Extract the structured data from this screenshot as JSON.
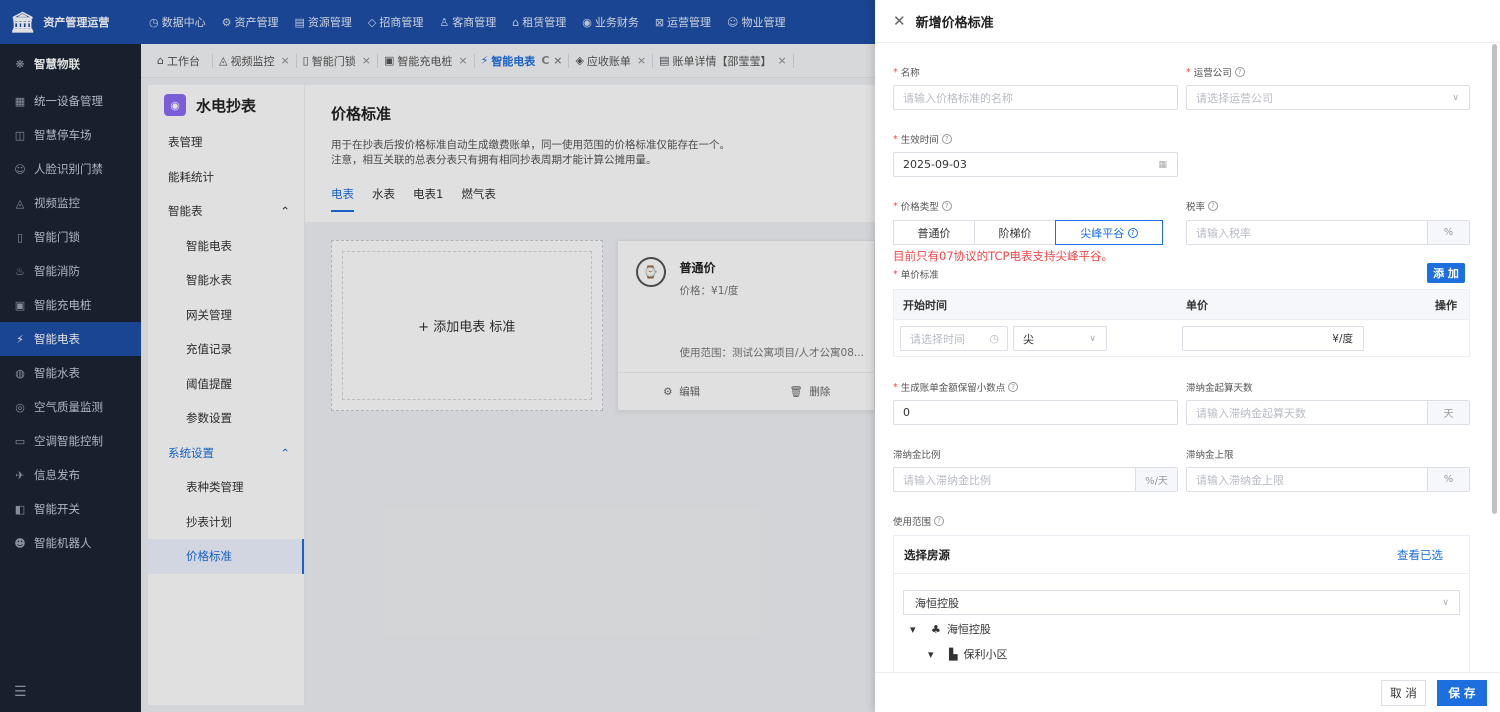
{
  "app": {
    "title": "资产管理运营"
  },
  "topnav": [
    {
      "icon": "◷",
      "label": "数据中心"
    },
    {
      "icon": "⚙",
      "label": "资产管理"
    },
    {
      "icon": "▤",
      "label": "资源管理"
    },
    {
      "icon": "◇",
      "label": "招商管理"
    },
    {
      "icon": "♙",
      "label": "客商管理"
    },
    {
      "icon": "⌂",
      "label": "租赁管理"
    },
    {
      "icon": "◉",
      "label": "业务财务"
    },
    {
      "icon": "⊠",
      "label": "运营管理"
    },
    {
      "icon": "☺",
      "label": "物业管理"
    }
  ],
  "sidebar": {
    "head": {
      "icon": "❋",
      "label": "智慧物联"
    },
    "items": [
      {
        "icon": "▦",
        "label": "统一设备管理"
      },
      {
        "icon": "◫",
        "label": "智慧停车场"
      },
      {
        "icon": "☺",
        "label": "人脸识别门禁"
      },
      {
        "icon": "◬",
        "label": "视频监控"
      },
      {
        "icon": "▯",
        "label": "智能门锁"
      },
      {
        "icon": "♨",
        "label": "智能消防"
      },
      {
        "icon": "▣",
        "label": "智能充电桩"
      },
      {
        "icon": "⚡",
        "label": "智能电表"
      },
      {
        "icon": "◍",
        "label": "智能水表"
      },
      {
        "icon": "◎",
        "label": "空气质量监测"
      },
      {
        "icon": "▭",
        "label": "空调智能控制"
      },
      {
        "icon": "✈",
        "label": "信息发布"
      },
      {
        "icon": "◧",
        "label": "智能开关"
      },
      {
        "icon": "☻",
        "label": "智能机器人"
      }
    ]
  },
  "tabs": [
    {
      "icon": "⌂",
      "label": "工作台",
      "close": ""
    },
    {
      "icon": "◬",
      "label": "视频监控",
      "close": "×"
    },
    {
      "icon": "▯",
      "label": "智能门锁",
      "close": "×"
    },
    {
      "icon": "▣",
      "label": "智能充电桩",
      "close": "×"
    },
    {
      "icon": "⚡",
      "label": "智能电表",
      "close": "C ×"
    },
    {
      "icon": "◈",
      "label": "应收账单",
      "close": "×"
    },
    {
      "icon": "▤",
      "label": "账单详情【邵莹莹】",
      "close": "×"
    }
  ],
  "subside": {
    "title": "水电抄表",
    "items": [
      {
        "label": "表管理",
        "arrow": "",
        "cls": ""
      },
      {
        "label": "能耗统计",
        "arrow": "",
        "cls": ""
      },
      {
        "label": "智能表",
        "arrow": "⌃",
        "cls": ""
      },
      {
        "label": "智能电表",
        "arrow": "",
        "cls": "sub"
      },
      {
        "label": "智能水表",
        "arrow": "",
        "cls": "sub"
      },
      {
        "label": "网关管理",
        "arrow": "",
        "cls": "sub"
      },
      {
        "label": "充值记录",
        "arrow": "",
        "cls": "sub"
      },
      {
        "label": "阈值提醒",
        "arrow": "",
        "cls": "sub"
      },
      {
        "label": "参数设置",
        "arrow": "",
        "cls": "sub"
      },
      {
        "label": "系统设置",
        "arrow": "⌃",
        "cls": "blue"
      },
      {
        "label": "表种类管理",
        "arrow": "",
        "cls": "sub"
      },
      {
        "label": "抄表计划",
        "arrow": "",
        "cls": "sub"
      },
      {
        "label": "价格标准",
        "arrow": "",
        "cls": "sub active"
      }
    ]
  },
  "main": {
    "title": "价格标准",
    "desc1": "用于在抄表后按价格标准自动生成缴费账单，同一使用范围的价格标准仅能存在一个。",
    "desc2": "注意，相互关联的总表分表只有拥有相同抄表周期才能计算公摊用量。",
    "tabs": [
      "电表",
      "水表",
      "电表1",
      "燃气表"
    ],
    "add_card": "+ 添加电表 标准",
    "card": {
      "name": "普通价",
      "price": "价格：¥1/度",
      "scope": "使用范围：测试公寓项目/人才公寓08...",
      "edit": "编辑",
      "delete": "删除"
    }
  },
  "drawer": {
    "title": "新增价格标准",
    "name_label": "名称",
    "name_ph": "请输入价格标准的名称",
    "company_label": "运营公司",
    "company_ph": "请选择运营公司",
    "effective_label": "生效时间",
    "effective_value": "2025-09-03",
    "price_type_label": "价格类型",
    "price_types": [
      "普通价",
      "阶梯价",
      "尖峰平谷"
    ],
    "tax_label": "税率",
    "tax_ph": "请输入税率",
    "tax_suffix": "%",
    "warning": "目前只有07协议的TCP电表支持尖峰平谷。",
    "unit_label": "单价标准",
    "add_btn": "添 加",
    "table_headers": [
      "开始时间",
      "单价",
      "操作"
    ],
    "row": {
      "time_ph": "请选择时间",
      "period": "尖",
      "price_suffix": "¥/度"
    },
    "decimal_label": "生成账单金额保留小数点",
    "decimal_value": "0",
    "late_days_label": "滞纳金起算天数",
    "late_days_ph": "请输入滞纳金起算天数",
    "late_days_suffix": "天",
    "late_ratio_label": "滞纳金比例",
    "late_ratio_ph": "请输入滞纳金比例",
    "late_ratio_suffix": "%/天",
    "late_cap_label": "滞纳金上限",
    "late_cap_ph": "请输入滞纳金上限",
    "late_cap_suffix": "%",
    "scope_label": "使用范围",
    "scope_head": "选择房源",
    "scope_link": "查看已选",
    "tree_select": "海恒控股",
    "tree_nodes": [
      "海恒控股",
      "保利小区"
    ],
    "cancel": "取 消",
    "save": "保 存"
  }
}
